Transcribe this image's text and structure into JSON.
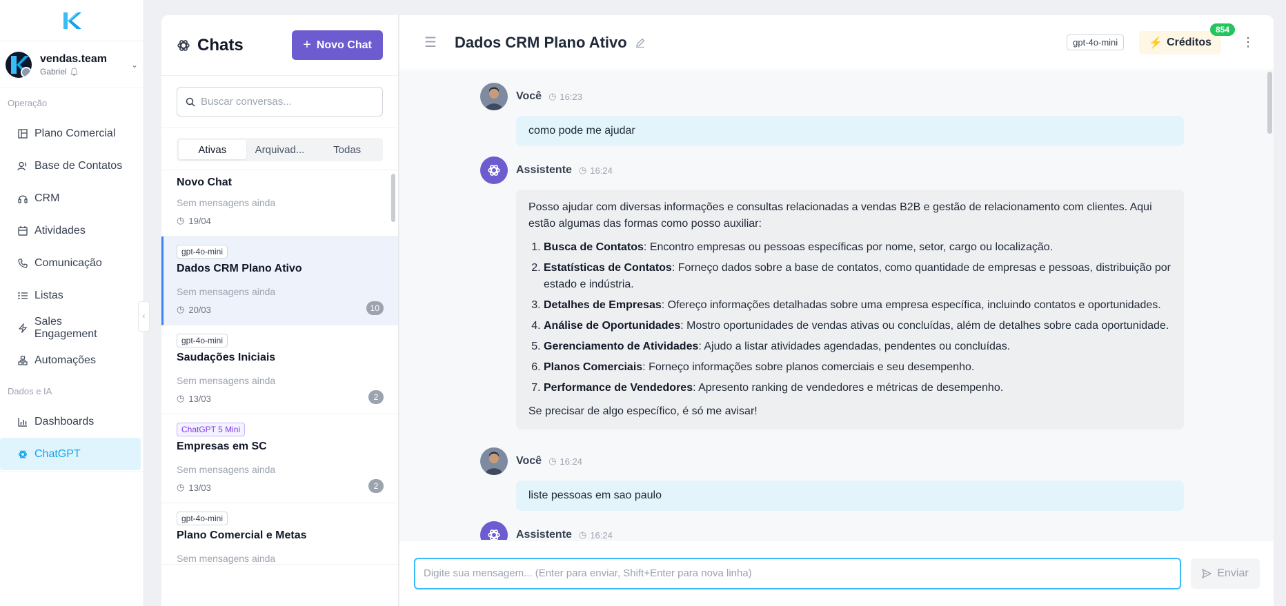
{
  "account": {
    "name": "vendas.team",
    "user": "Gabriel"
  },
  "sidebar": {
    "sections": [
      {
        "label": "Operação",
        "items": [
          {
            "label": "Plano Comercial",
            "icon": "board-icon"
          },
          {
            "label": "Base de Contatos",
            "icon": "contacts-icon"
          },
          {
            "label": "CRM",
            "icon": "headset-icon"
          },
          {
            "label": "Atividades",
            "icon": "calendar-icon"
          },
          {
            "label": "Comunicação",
            "icon": "phone-icon"
          },
          {
            "label": "Listas",
            "icon": "list-icon"
          },
          {
            "label": "Sales Engagement",
            "icon": "bolt-icon"
          },
          {
            "label": "Automações",
            "icon": "workflow-icon"
          }
        ]
      },
      {
        "label": "Dados e IA",
        "items": [
          {
            "label": "Dashboards",
            "icon": "chart-icon"
          },
          {
            "label": "ChatGPT",
            "icon": "openai-icon",
            "active": true
          }
        ]
      }
    ]
  },
  "chat_list": {
    "title": "Chats",
    "new_chat_label": "Novo Chat",
    "search_placeholder": "Buscar conversas...",
    "tabs": [
      "Ativas",
      "Arquivad...",
      "Todas"
    ],
    "conversations": [
      {
        "badge": "",
        "title": "Novo Chat",
        "subtitle": "Sem mensagens ainda",
        "date": "19/04",
        "count": ""
      },
      {
        "badge": "gpt-4o-mini",
        "title": "Dados CRM Plano Ativo",
        "subtitle": "Sem mensagens ainda",
        "date": "20/03",
        "count": "10",
        "active": true
      },
      {
        "badge": "gpt-4o-mini",
        "title": "Saudações Iniciais",
        "subtitle": "Sem mensagens ainda",
        "date": "13/03",
        "count": "2"
      },
      {
        "badge": "ChatGPT 5 Mini",
        "title": "Empresas em SC",
        "subtitle": "Sem mensagens ainda",
        "date": "13/03",
        "count": "2"
      },
      {
        "badge": "gpt-4o-mini",
        "title": "Plano Comercial e Metas",
        "subtitle": "Sem mensagens ainda",
        "date": "",
        "count": ""
      }
    ]
  },
  "chat": {
    "title": "Dados CRM Plano Ativo",
    "model": "gpt-4o-mini",
    "credits_label": "Créditos",
    "credits_count": "854",
    "messages": [
      {
        "author": "Você",
        "time": "16:23",
        "text": "como pode me ajudar"
      },
      {
        "author": "Assistente",
        "time": "16:24",
        "intro": "Posso ajudar com diversas informações e consultas relacionadas a vendas B2B e gestão de relacionamento com clientes. Aqui estão algumas das formas como posso auxiliar:",
        "items": [
          {
            "bold": "Busca de Contatos",
            "text": ": Encontro empresas ou pessoas específicas por nome, setor, cargo ou localização."
          },
          {
            "bold": "Estatísticas de Contatos",
            "text": ": Forneço dados sobre a base de contatos, como quantidade de empresas e pessoas, distribuição por estado e indústria."
          },
          {
            "bold": "Detalhes de Empresas",
            "text": ": Ofereço informações detalhadas sobre uma empresa específica, incluindo contatos e oportunidades."
          },
          {
            "bold": "Análise de Oportunidades",
            "text": ": Mostro oportunidades de vendas ativas ou concluídas, além de detalhes sobre cada oportunidade."
          },
          {
            "bold": "Gerenciamento de Atividades",
            "text": ": Ajudo a listar atividades agendadas, pendentes ou concluídas."
          },
          {
            "bold": "Planos Comerciais",
            "text": ": Forneço informações sobre planos comerciais e seu desempenho."
          },
          {
            "bold": "Performance de Vendedores",
            "text": ": Apresento ranking de vendedores e métricas de desempenho."
          }
        ],
        "outro": "Se precisar de algo específico, é só me avisar!"
      },
      {
        "author": "Você",
        "time": "16:24",
        "text": "liste pessoas em sao paulo"
      },
      {
        "author": "Assistente",
        "time": "16:24"
      }
    ],
    "input_placeholder": "Digite sua mensagem... (Enter para enviar, Shift+Enter para nova linha)",
    "send_label": "Enviar"
  },
  "colors": {
    "accent": "#6d5bd0",
    "active_nav": "#0ea5e9",
    "credits_badge": "#22c55e"
  }
}
